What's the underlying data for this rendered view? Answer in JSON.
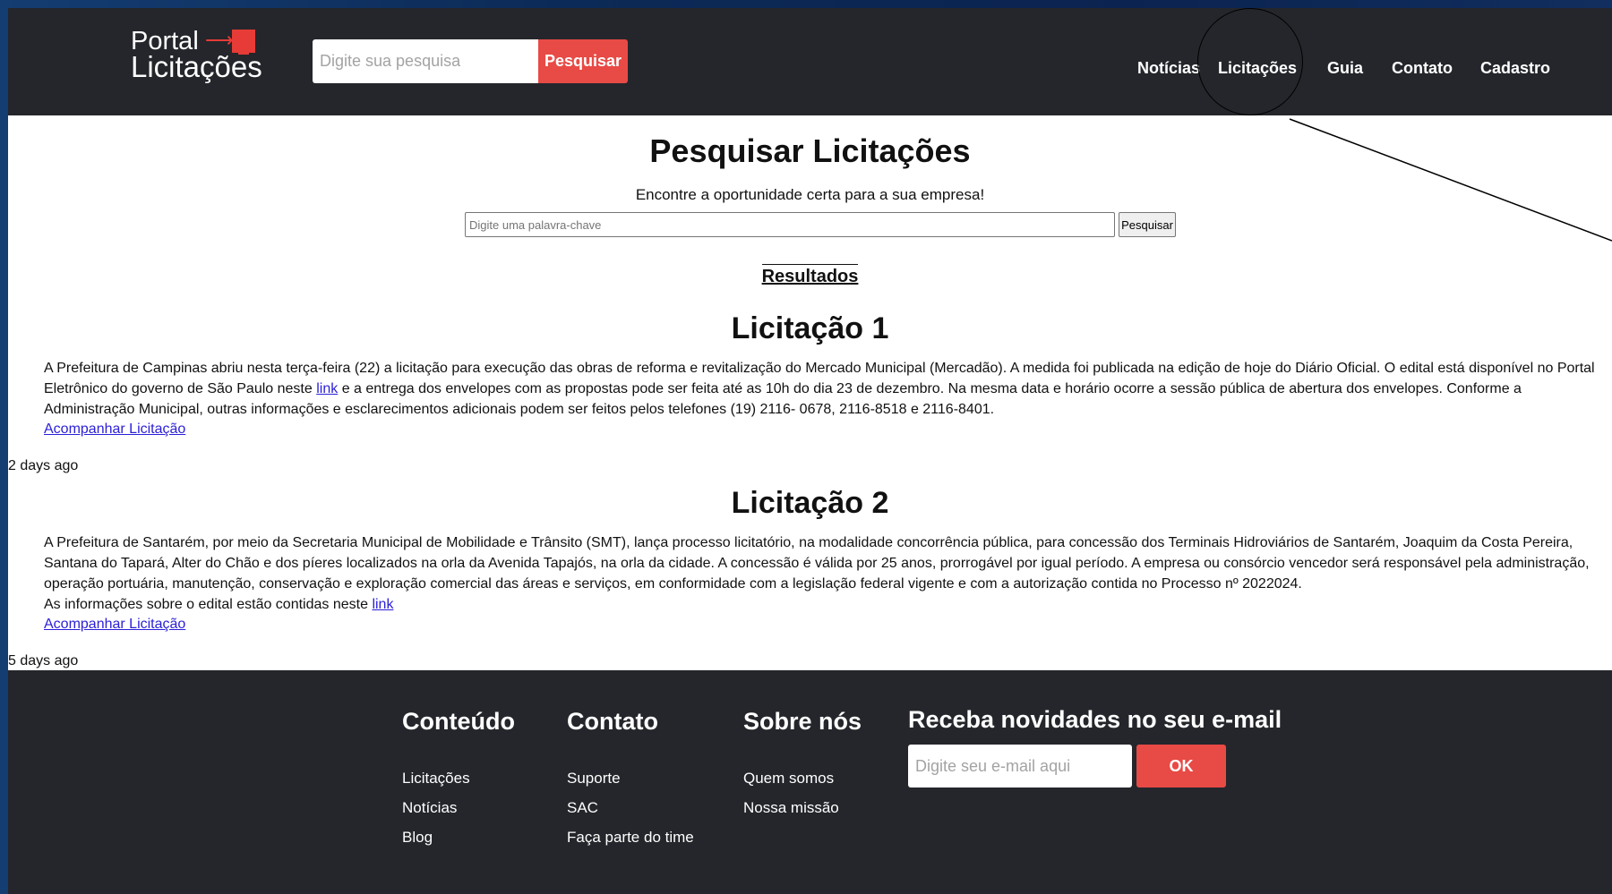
{
  "header": {
    "logo_line1": "Portal",
    "logo_line2": "Licitações",
    "search_placeholder": "Digite sua pesquisa",
    "search_button": "Pesquisar",
    "nav": [
      "Notícias",
      "Licitações",
      "Guia",
      "Contato",
      "Cadastro"
    ]
  },
  "main": {
    "title": "Pesquisar Licitações",
    "subtitle": "Encontre a oportunidade certa para a sua empresa!",
    "keyword_placeholder": "Digite uma palavra-chave",
    "keyword_button": "Pesquisar",
    "results_heading": "Resultados",
    "follow_label": "Acompanhar Licitação",
    "items": [
      {
        "title": "Licitação 1",
        "text_before_link": "A Prefeitura de Campinas abriu nesta terça-feira (22) a licitação para execução das obras de reforma e revitalização do Mercado Municipal (Mercadão). A medida foi publicada na edição de hoje do Diário Oficial. O edital está disponível no Portal Eletrônico do governo de São Paulo neste",
        "link_text": "link",
        "text_after_link": "e a entrega dos envelopes com as propostas pode ser feita até as 10h do dia 23 de dezembro. Na mesma data e horário ocorre a sessão pública de abertura dos envelopes. Conforme a Administração Municipal, outras informações e esclarecimentos adicionais podem ser feitos pelos telefones (19) 2116- 0678, 2116-8518 e 2116-8401.",
        "age": "2 days ago"
      },
      {
        "title": "Licitação 2",
        "text": "A Prefeitura de Santarém, por meio da Secretaria Municipal de Mobilidade e Trânsito (SMT), lança processo licitatório, na modalidade concorrência pública, para concessão dos Terminais Hidroviários de Santarém, Joaquim da Costa Pereira, Santana do Tapará, Alter do Chão e dos píeres localizados na orla da Avenida Tapajós, na orla da cidade. A concessão é válida por 25 anos, prorrogável por igual período. A empresa ou consórcio vencedor será responsável pela administração, operação portuária, manutenção, conservação e exploração comercial das áreas e serviços, em conformidade com a legislação federal vigente e com a autorização contida no Processo nº 2022024.",
        "edital_text": "As informações sobre o edital estão contidas neste",
        "link_text": "link",
        "age": "5 days ago"
      }
    ]
  },
  "footer": {
    "columns": [
      {
        "title": "Conteúdo",
        "links": [
          "Licitações",
          "Notícias",
          "Blog"
        ]
      },
      {
        "title": "Contato",
        "links": [
          "Suporte",
          "SAC",
          "Faça parte do time"
        ]
      },
      {
        "title": "Sobre nós",
        "links": [
          "Quem somos",
          "Nossa missão"
        ]
      }
    ],
    "newsletter_title": "Receba novidades no seu e-mail",
    "newsletter_placeholder": "Digite seu e-mail aqui",
    "newsletter_button": "OK"
  },
  "colors": {
    "header_bg": "#24262b",
    "accent": "#e84a45",
    "link": "#2b1fd6",
    "outer_bg": "#0c2a57"
  },
  "icons": [
    "logo-monitor-icon",
    "logo-arrow-icon"
  ]
}
